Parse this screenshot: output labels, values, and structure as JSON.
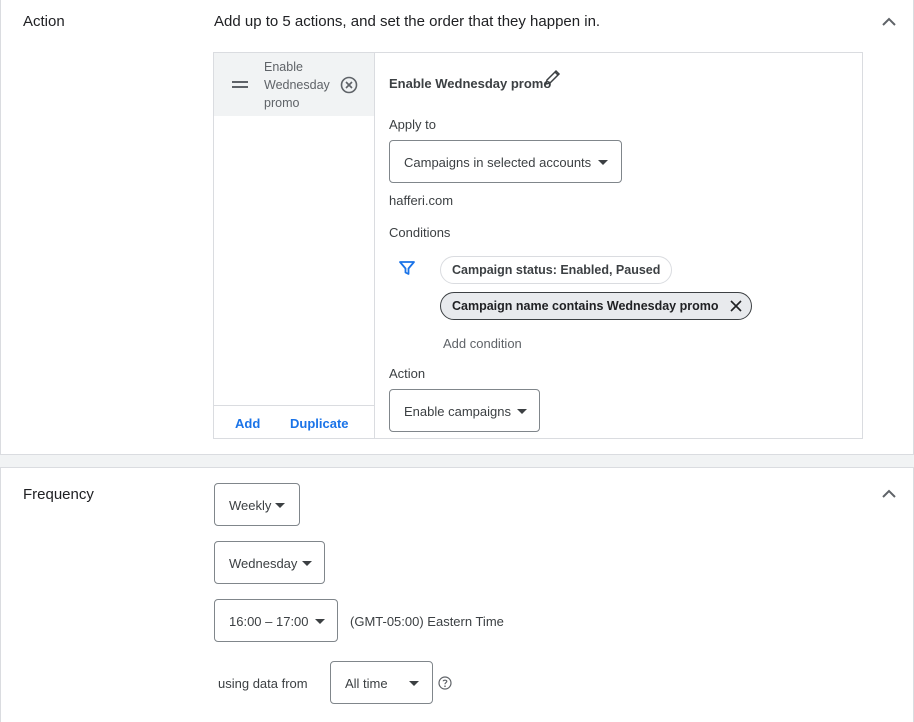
{
  "action_section": {
    "title": "Action",
    "description": "Add up to 5 actions, and set the order that they happen in.",
    "list": {
      "items": [
        {
          "label": "Enable Wednesday promo"
        }
      ],
      "add_label": "Add",
      "duplicate_label": "Duplicate"
    },
    "detail": {
      "title": "Enable Wednesday promo",
      "apply_to_label": "Apply to",
      "apply_to_value": "Campaigns in selected accounts",
      "account": "hafferi.com",
      "conditions_label": "Conditions",
      "conditions": [
        {
          "text": "Campaign status: Enabled, Paused"
        },
        {
          "text": "Campaign name contains Wednesday promo"
        }
      ],
      "add_condition": "Add condition",
      "action_label": "Action",
      "action_value": "Enable campaigns"
    }
  },
  "frequency_section": {
    "title": "Frequency",
    "frequency_value": "Weekly",
    "day_value": "Wednesday",
    "time_value": "16:00 – 17:00",
    "timezone": "(GMT-05:00) Eastern Time",
    "using_data_label": "using data from",
    "data_range_value": "All time"
  },
  "icons": {
    "collapse": "chevron-up-icon",
    "drag": "drag-handle-icon",
    "remove": "cancel-circle-icon",
    "edit": "pencil-icon",
    "filter": "filter-icon",
    "chip_remove": "close-icon",
    "help": "help-circle-icon"
  },
  "colors": {
    "accent": "#1a73e8",
    "text": "#3c4043",
    "border": "#dadce0"
  }
}
